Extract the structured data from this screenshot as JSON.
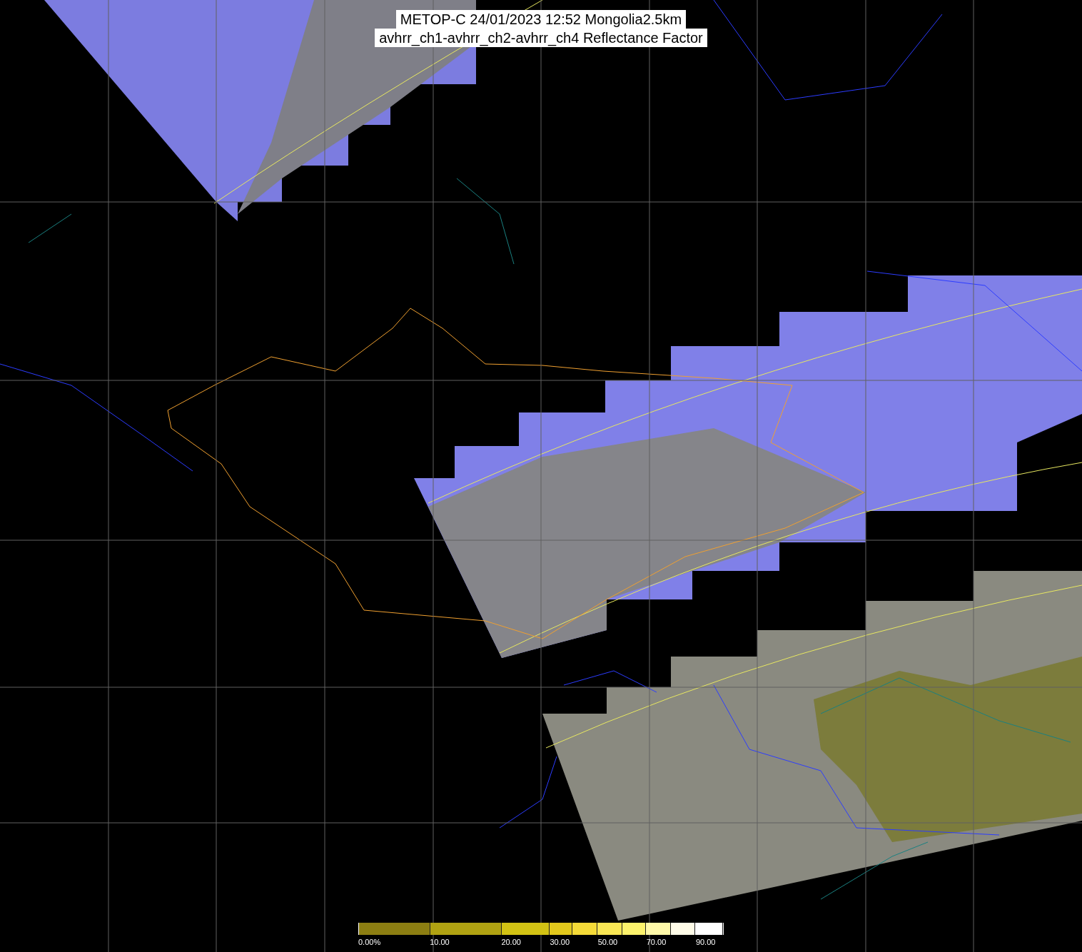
{
  "title": {
    "lines": [
      "METOP-C 24/01/2023 12:52 Mongolia2.5km",
      "avhrr_ch1-avhrr_ch2-avhrr_ch4 Reflectance Factor"
    ]
  },
  "colorbar": {
    "segments": [
      {
        "color": "#8c7e12",
        "label": "0.00%"
      },
      {
        "color": "#b0a212",
        "label": "10.00"
      },
      {
        "color": "#d2c214",
        "label": "20.00"
      },
      {
        "color": "#e2c81c",
        "label": "30.00"
      },
      {
        "color": "#f4da38"
      },
      {
        "color": "#f8e654",
        "label": "50.00"
      },
      {
        "color": "#fcf26c"
      },
      {
        "color": "#fef8a8",
        "label": "70.00"
      },
      {
        "color": "#fffce8"
      },
      {
        "color": "#ffffff",
        "label": "90.00"
      }
    ]
  }
}
